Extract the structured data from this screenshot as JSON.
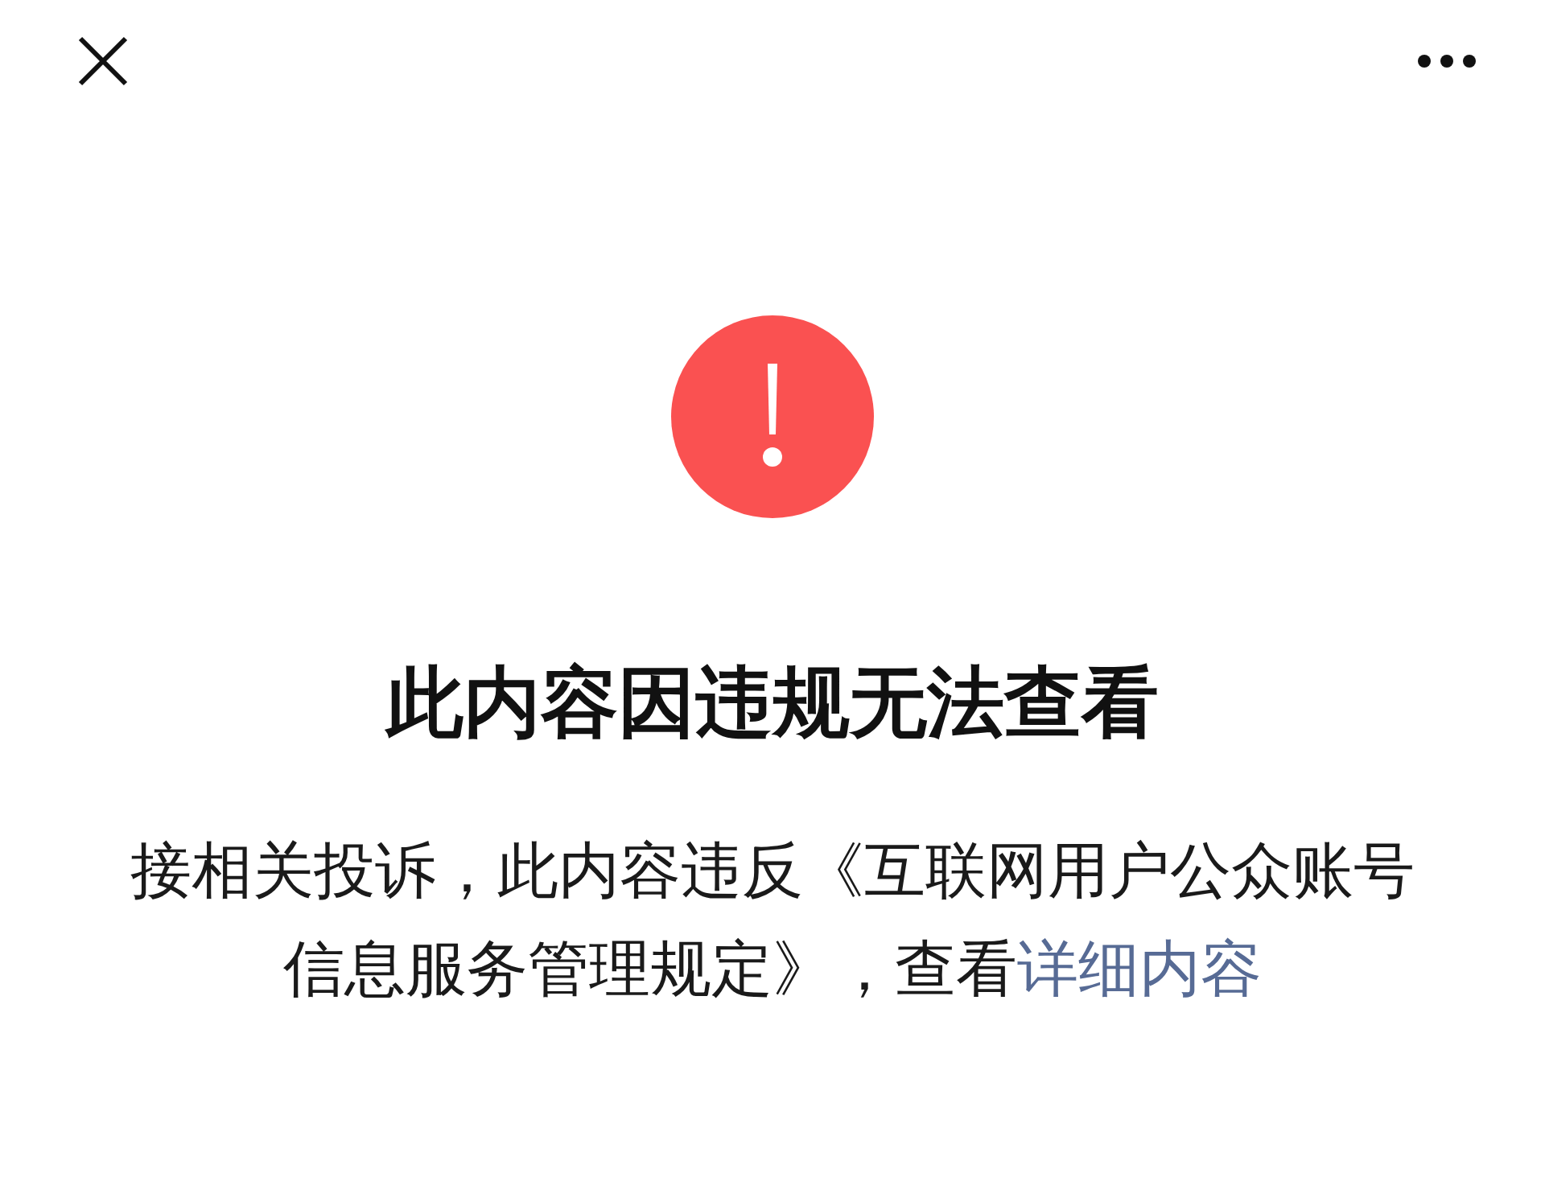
{
  "alert": {
    "title": "此内容因违规无法查看",
    "message": "接相关投诉，此内容违反《互联网用户公众账号信息服务管理规定》，查看",
    "link": "详细内容"
  }
}
